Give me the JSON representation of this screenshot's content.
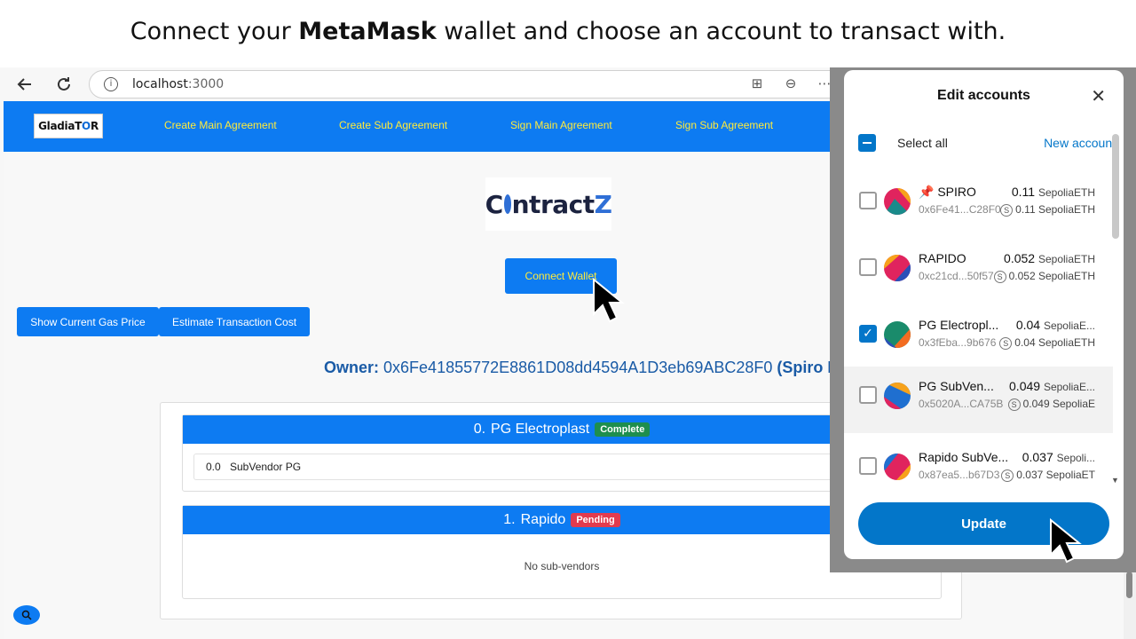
{
  "caption": {
    "prefix": "Connect your ",
    "bold": "MetaMask",
    "suffix": " wallet and choose an account to transact with."
  },
  "browser": {
    "url_host": "localhost",
    "url_port": ":3000",
    "url_placeholder": "localhost:3000"
  },
  "nav": {
    "logo_prefix": "Gladia",
    "logo_mid": "T",
    "logo_o": "O",
    "logo_suffix": "R",
    "links": [
      "Create Main Agreement",
      "Create Sub Agreement",
      "Sign Main Agreement",
      "Sign Sub Agreement"
    ]
  },
  "brand": {
    "c": "C",
    "rest": "ntract",
    "z": "Z"
  },
  "buttons": {
    "connect": "Connect Wallet",
    "gas": "Show Current Gas Price",
    "estimate": "Estimate Transaction Cost"
  },
  "owner": {
    "label": "Owner:",
    "address": "0x6Fe41855772E8861D08dd4594A1D3eb69ABC28F0",
    "name": "(Spiro I"
  },
  "agreements": [
    {
      "index": "0.",
      "name": "PG Electroplast",
      "status": "Complete",
      "subs": [
        {
          "index": "0.0",
          "name": "SubVendor PG"
        }
      ]
    },
    {
      "index": "1.",
      "name": "Rapido",
      "status": "Pending",
      "empty_text": "No sub-vendors"
    }
  ],
  "metamask": {
    "title": "Edit accounts",
    "select_all": "Select all",
    "new_account": "New account",
    "update": "Update",
    "accounts": [
      {
        "name": "SPIRO",
        "pinned": true,
        "balance": "0.11",
        "unit": "SepoliaETH",
        "address": "0x6Fe41...C28F0",
        "sub_balance": "0.11 SepoliaETH",
        "checked": false,
        "colors": [
          "#e0245e",
          "#f7a21b",
          "#1a8b8b"
        ]
      },
      {
        "name": "RAPIDO",
        "pinned": false,
        "balance": "0.052",
        "unit": "SepoliaETH",
        "address": "0xc21cd...50f57",
        "sub_balance": "0.052 SepoliaETH",
        "checked": false,
        "colors": [
          "#e0245e",
          "#f7a21b",
          "#2a4fb8"
        ]
      },
      {
        "name": "PG Electropl...",
        "pinned": false,
        "balance": "0.04",
        "unit": "SepoliaE...",
        "address": "0x3fEba...9b676",
        "sub_balance": "0.04 SepoliaETH",
        "checked": true,
        "colors": [
          "#1a8b6b",
          "#f36c21",
          "#2a4fb8"
        ]
      },
      {
        "name": "PG SubVen...",
        "pinned": false,
        "balance": "0.049",
        "unit": "SepoliaE...",
        "address": "0x5020A...CA75B",
        "sub_balance": "0.049 SepoliaE",
        "checked": false,
        "colors": [
          "#1f6fd0",
          "#f7a21b",
          "#e0245e"
        ]
      },
      {
        "name": "Rapido SubVe...",
        "pinned": false,
        "balance": "0.037",
        "unit": "Sepoli...",
        "address": "0x87ea5...b67D3",
        "sub_balance": "0.037 SepoliaET",
        "checked": false,
        "colors": [
          "#e0245e",
          "#1f6fd0",
          "#f7a21b"
        ]
      }
    ]
  }
}
